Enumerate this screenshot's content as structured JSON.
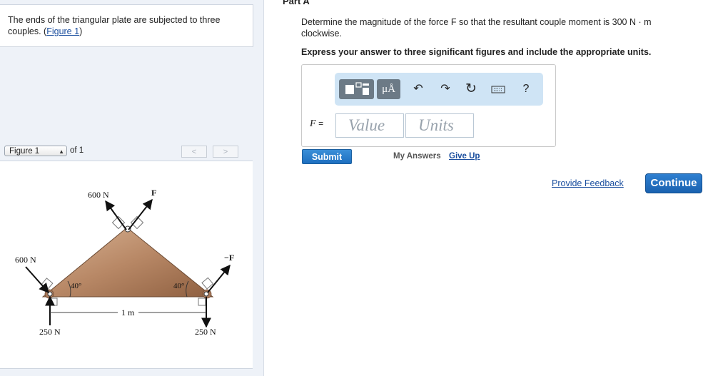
{
  "problem": {
    "text": "The ends of the triangular plate are subjected to three couples. (",
    "link": "Figure 1",
    "close": ")"
  },
  "figure_nav": {
    "selected": "Figure 1",
    "of_text": "of 1",
    "prev": "<",
    "next": ">"
  },
  "figure": {
    "top_left_force": "600 N",
    "top_right_force": "F",
    "left_force": "600 N",
    "right_force": "−F",
    "angle_left": "40°",
    "angle_right": "40°",
    "span": "1 m",
    "bottom_left": "250 N",
    "bottom_right": "250 N"
  },
  "part": {
    "title": "Part A",
    "question": "Determine the magnitude of the force F so that the resultant couple moment is 300  N · m clockwise.",
    "instruction": "Express your answer to three significant figures and include the appropriate units."
  },
  "toolbar": {
    "mu_label": "μÅ",
    "help": "?"
  },
  "answer": {
    "variable": "F",
    "equals": "=",
    "value_placeholder": "Value",
    "units_placeholder": "Units"
  },
  "actions": {
    "submit": "Submit",
    "my_answers": "My Answers",
    "give_up": "Give Up",
    "feedback": "Provide Feedback",
    "continue": "Continue"
  },
  "colors": {
    "accent": "#1e6fc0",
    "link": "#1a4e9e",
    "toolbar_bg": "#cfe4f5",
    "plate": "#b88866"
  }
}
